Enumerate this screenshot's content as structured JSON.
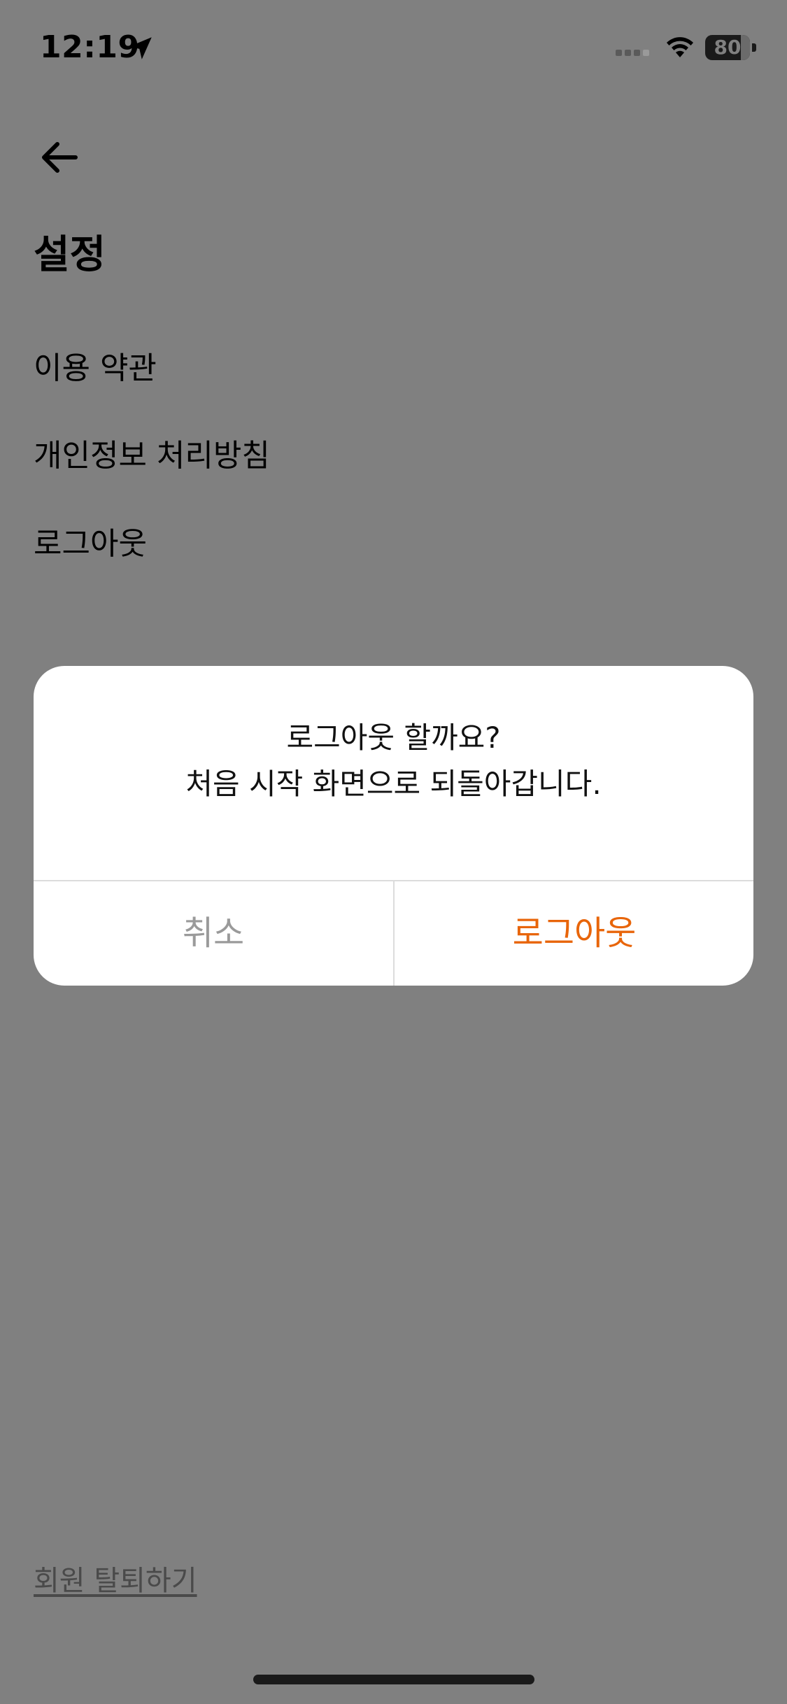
{
  "status_bar": {
    "time": "12:19",
    "battery": "80",
    "battery_level": 0.8,
    "icons": [
      "location-arrow-icon",
      "cellular-signal-icon",
      "wifi-icon",
      "battery-icon"
    ]
  },
  "header": {
    "back_icon": "arrow-left-icon",
    "title": "설정"
  },
  "menu": {
    "items": [
      {
        "label": "이용 약관"
      },
      {
        "label": "개인정보 처리방침"
      },
      {
        "label": "로그아웃"
      }
    ]
  },
  "dialog": {
    "title": "로그아웃 할까요?",
    "message": "처음 시작 화면으로 되돌아갑니다.",
    "cancel_label": "취소",
    "confirm_label": "로그아웃"
  },
  "footer": {
    "withdraw_label": "회원 탈퇴하기"
  },
  "colors": {
    "overlay_background": "#808080",
    "dialog_background": "#ffffff",
    "accent": "#e8650a",
    "cancel_text": "#9a9a9a"
  }
}
